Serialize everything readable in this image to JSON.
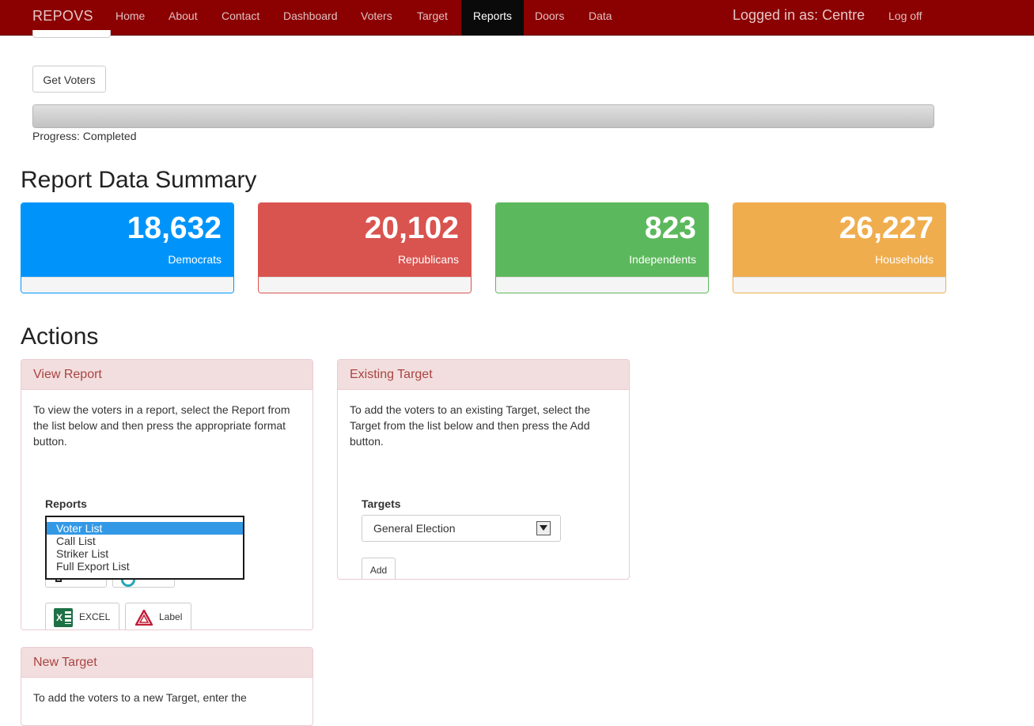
{
  "nav": {
    "brand": "REPOVS",
    "items": [
      "Home",
      "About",
      "Contact",
      "Dashboard",
      "Voters",
      "Target",
      "Reports",
      "Doors",
      "Data"
    ],
    "active": "Reports",
    "logged_in": "Logged in as: Centre",
    "logoff": "Log off"
  },
  "top": {
    "get_voters": "Get Voters",
    "progress_percent": 100,
    "progress_text": "Progress: Completed"
  },
  "summary": {
    "title": "Report Data Summary",
    "cards": [
      {
        "value": "18,632",
        "label": "Democrats",
        "color": "#0094fb"
      },
      {
        "value": "20,102",
        "label": "Republicans",
        "color": "#d9534f"
      },
      {
        "value": "823",
        "label": "Independents",
        "color": "#5cb85c"
      },
      {
        "value": "26,227",
        "label": "Households",
        "color": "#f0ad4e"
      }
    ]
  },
  "actions": {
    "title": "Actions",
    "view_report": {
      "title": "View Report",
      "text": "To view the voters in a report, select the Report from the list below and then press the appropriate format button.",
      "list_label": "Reports",
      "options": [
        "Voter List",
        "Call List",
        "Striker List",
        "Full Export List"
      ],
      "selected": "Voter List",
      "excel": "EXCEL",
      "label": "Label"
    },
    "existing_target": {
      "title": "Existing Target",
      "text": "To add the voters to an existing Target, select the Target from the list below and then press the Add button.",
      "targets_label": "Targets",
      "selected": "General Election",
      "add": "Add"
    },
    "new_target": {
      "title": "New Target",
      "text": "To add the voters to a new Target, enter the"
    }
  }
}
